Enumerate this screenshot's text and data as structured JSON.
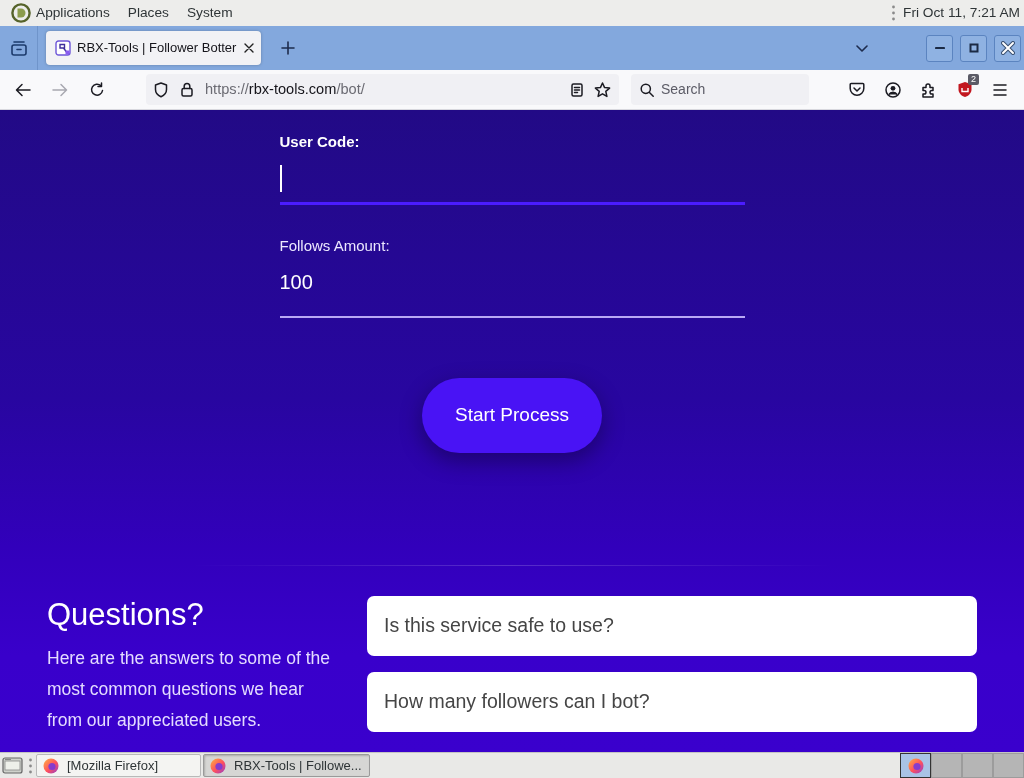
{
  "top_panel": {
    "menus": [
      "Applications",
      "Places",
      "System"
    ],
    "clock": "Fri Oct 11, 7:21 AM"
  },
  "browser": {
    "tabs": [
      {
        "title": "RBX-Tools | Follower Botter",
        "selected": true
      }
    ],
    "forward_disabled": true,
    "url": {
      "scheme": "https://",
      "host": "rbx-tools.com",
      "path": "/bot/"
    },
    "search": {
      "placeholder": "Search"
    },
    "extension_badge": "2"
  },
  "form": {
    "fields": [
      {
        "label": "User Code:",
        "focused": true
      },
      {
        "label": "Follows Amount:",
        "value": "100",
        "focused": false
      }
    ],
    "submit_button": "Start Process"
  },
  "faq": {
    "title": "Questions?",
    "intro": "Here are the answers to some of the most common questions we hear from our appreciated users.",
    "questions": [
      "Is this service safe to use?",
      "How many followers can I bot?"
    ]
  },
  "taskbar": {
    "tasks": [
      {
        "label": "[Mozilla Firefox]",
        "selected": false
      },
      {
        "label": "RBX-Tools | Followe...",
        "selected": true
      }
    ],
    "workspaces": [
      {
        "selected": true
      },
      {
        "selected": false
      },
      {
        "selected": false
      },
      {
        "selected": false
      }
    ]
  }
}
